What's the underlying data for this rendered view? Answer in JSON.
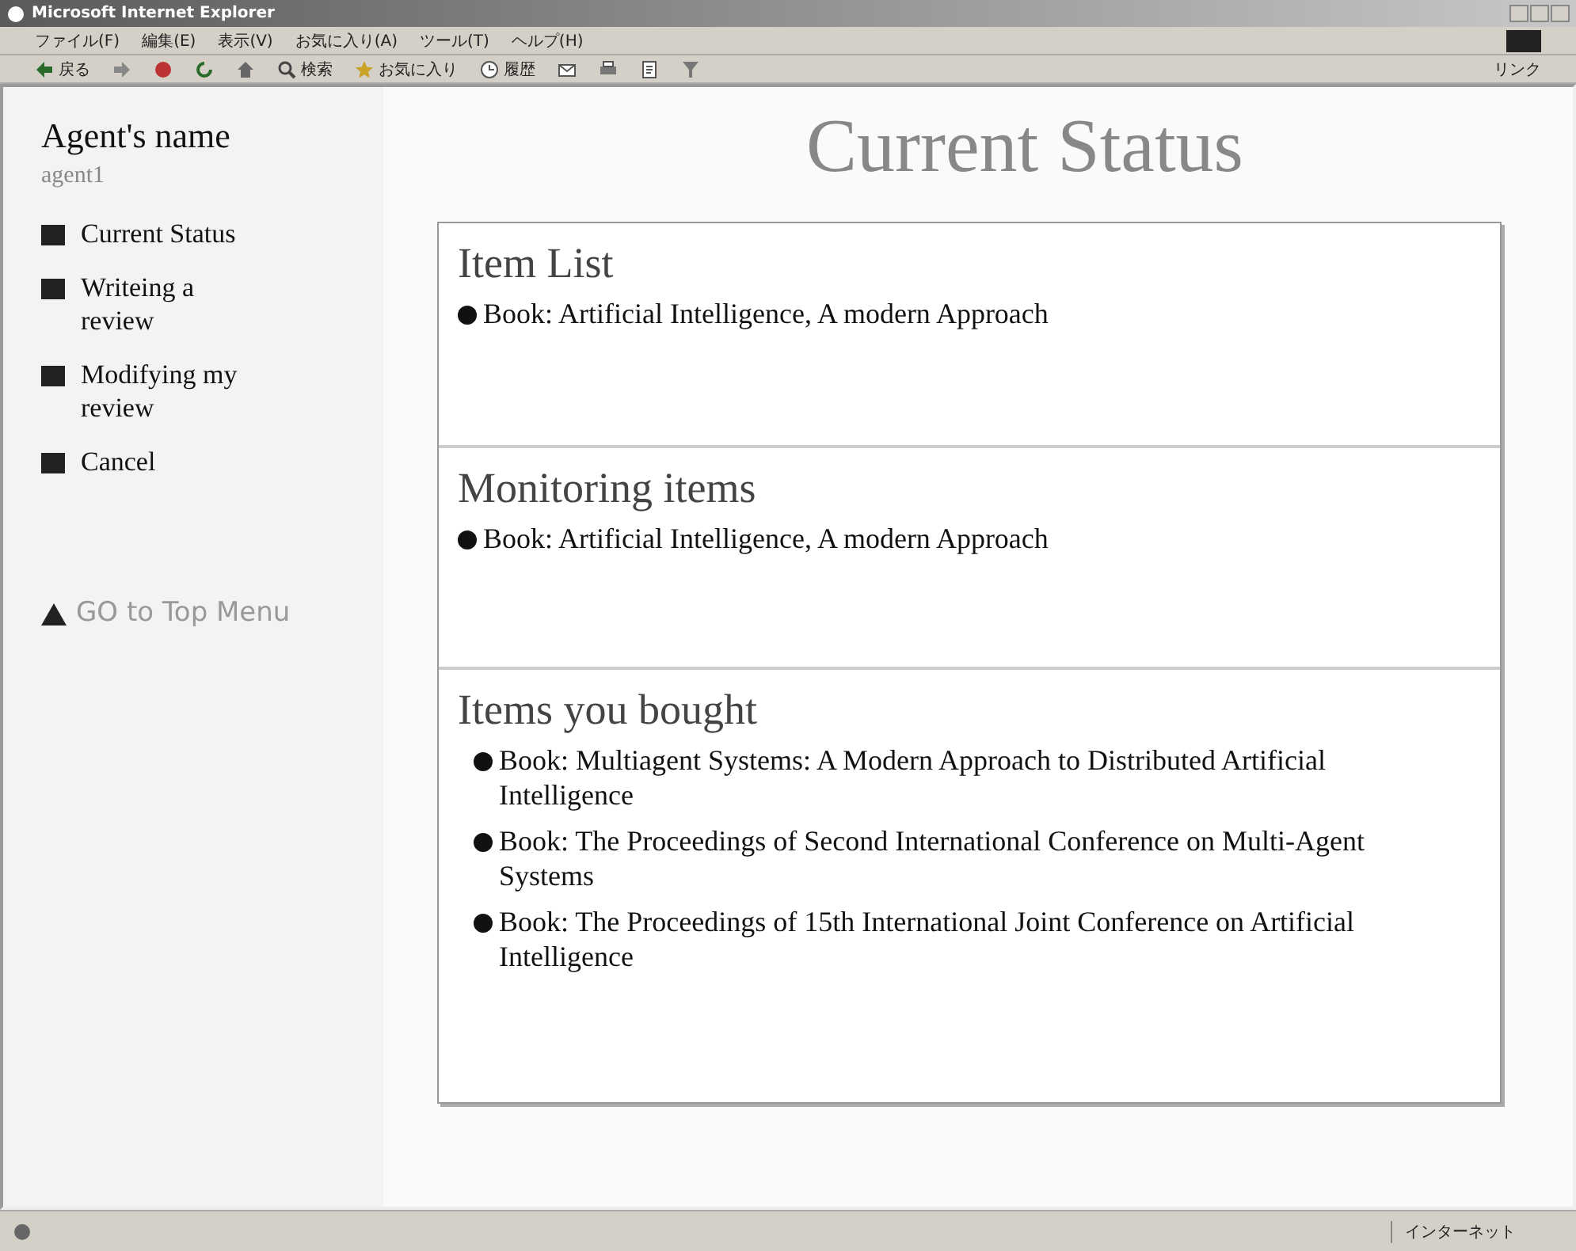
{
  "window": {
    "title": "Microsoft Internet Explorer"
  },
  "menu": [
    "ファイル(F)",
    "編集(E)",
    "表示(V)",
    "お気に入り(A)",
    "ツール(T)",
    "ヘルプ(H)"
  ],
  "toolbar": [
    {
      "kind": "back",
      "label": "戻る"
    },
    {
      "kind": "forward"
    },
    {
      "kind": "stop"
    },
    {
      "kind": "refresh"
    },
    {
      "kind": "home"
    },
    {
      "kind": "search",
      "label": "検索"
    },
    {
      "kind": "favorites",
      "label": "お気に入り"
    },
    {
      "kind": "history",
      "label": "履歴"
    },
    {
      "kind": "mail"
    },
    {
      "kind": "print"
    },
    {
      "kind": "edit"
    },
    {
      "kind": "discuss"
    }
  ],
  "links_label": "リンク",
  "sidebar": {
    "agent_label": "Agent's name",
    "agent_name": "agent1",
    "items": [
      "Current Status",
      "Writeing a review",
      "Modifying my review",
      "Cancel"
    ],
    "top_link": "GO to Top Menu"
  },
  "page_title": "Current Status",
  "sections": [
    {
      "title": "Item List",
      "items": [
        "Book: Artificial Intelligence, A modern Approach"
      ]
    },
    {
      "title": "Monitoring items",
      "items": [
        "Book: Artificial Intelligence, A modern Approach"
      ]
    },
    {
      "title": "Items you bought",
      "items": [
        "Book: Multiagent Systems: A Modern Approach to Distributed Artificial Intelligence",
        "Book: The Proceedings of Second International Conference on Multi-Agent Systems",
        "Book: The Proceedings of 15th International Joint Conference on Artificial Intelligence"
      ]
    }
  ],
  "status_bar": {
    "zone": "インターネット"
  }
}
